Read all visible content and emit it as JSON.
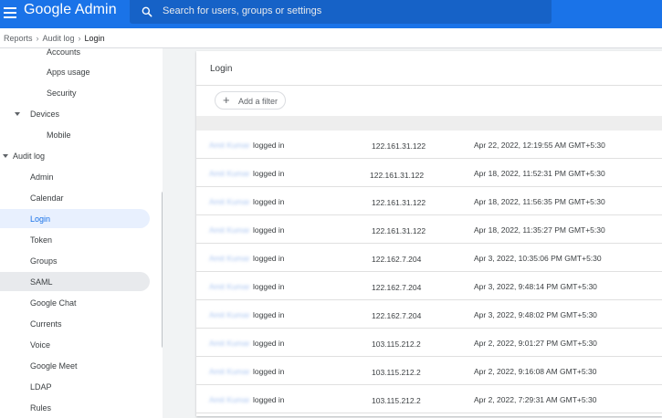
{
  "header": {
    "app_name": "Google Admin",
    "search_placeholder": "Search for users, groups or settings",
    "icons": [
      "menu-icon",
      "search-icon"
    ]
  },
  "breadcrumb": [
    "Reports",
    "Audit log",
    "Login"
  ],
  "sidebar": {
    "items": [
      {
        "label": "Accounts"
      },
      {
        "label": "Apps usage"
      },
      {
        "label": "Security"
      },
      {
        "label": "Devices"
      },
      {
        "label": "Mobile"
      },
      {
        "label": "Audit log"
      },
      {
        "label": "Admin"
      },
      {
        "label": "Calendar"
      },
      {
        "label": "Login"
      },
      {
        "label": "Token"
      },
      {
        "label": "Groups"
      },
      {
        "label": "SAML"
      },
      {
        "label": "Google Chat"
      },
      {
        "label": "Currents"
      },
      {
        "label": "Voice"
      },
      {
        "label": "Google Meet"
      },
      {
        "label": "LDAP"
      },
      {
        "label": "Rules"
      }
    ]
  },
  "main": {
    "title": "Login",
    "filter_label": "Add a filter",
    "rows": [
      {
        "user": "Amit Kumar",
        "action": "logged in",
        "ip": "122.161.31.122",
        "date": "Apr 22, 2022, 12:19:55 AM GMT+5:30"
      },
      {
        "user": "Amit Kumar",
        "action": "logged in",
        "ip": "122.161.31.122",
        "date": "Apr 18, 2022, 11:52:31 PM GMT+5:30"
      },
      {
        "user": "Amit Kumar",
        "action": "logged in",
        "ip": "122.161.31.122",
        "date": "Apr 18, 2022, 11:56:35 PM GMT+5:30"
      },
      {
        "user": "Amit Kumar",
        "action": "logged in",
        "ip": "122.161.31.122",
        "date": "Apr 18, 2022, 11:35:27 PM GMT+5:30"
      },
      {
        "user": "Amit Kumar",
        "action": "logged in",
        "ip": "122.162.7.204",
        "date": "Apr 3, 2022, 10:35:06 PM GMT+5:30"
      },
      {
        "user": "Amit Kumar",
        "action": "logged in",
        "ip": "122.162.7.204",
        "date": "Apr 3, 2022, 9:48:14 PM GMT+5:30"
      },
      {
        "user": "Amit Kumar",
        "action": "logged in",
        "ip": "122.162.7.204",
        "date": "Apr 3, 2022, 9:48:02 PM GMT+5:30"
      },
      {
        "user": "Amit Kumar",
        "action": "logged in",
        "ip": "103.115.212.2",
        "date": "Apr 2, 2022, 9:01:27 PM GMT+5:30"
      },
      {
        "user": "Amit Kumar",
        "action": "logged in",
        "ip": "103.115.212.2",
        "date": "Apr 2, 2022, 9:16:08 AM GMT+5:30"
      },
      {
        "user": "Amit Kumar",
        "action": "logged in",
        "ip": "103.115.212.2",
        "date": "Apr 2, 2022, 7:29:31 AM GMT+5:30"
      }
    ]
  },
  "colors": {
    "brand": "#1a73e8",
    "active_bg": "#e8f0fe",
    "hover_bg": "#e8eaed"
  }
}
